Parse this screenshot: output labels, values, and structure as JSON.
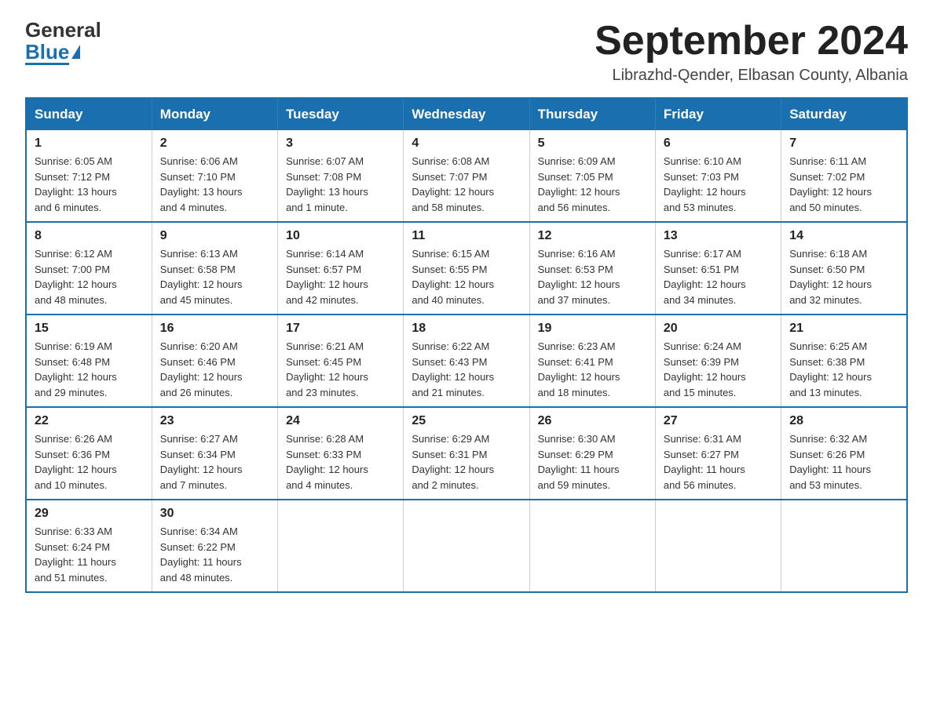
{
  "header": {
    "logo_general": "General",
    "logo_blue": "Blue",
    "month_title": "September 2024",
    "subtitle": "Librazhd-Qender, Elbasan County, Albania"
  },
  "calendar": {
    "days_of_week": [
      "Sunday",
      "Monday",
      "Tuesday",
      "Wednesday",
      "Thursday",
      "Friday",
      "Saturday"
    ],
    "weeks": [
      [
        {
          "day": "1",
          "info": "Sunrise: 6:05 AM\nSunset: 7:12 PM\nDaylight: 13 hours\nand 6 minutes."
        },
        {
          "day": "2",
          "info": "Sunrise: 6:06 AM\nSunset: 7:10 PM\nDaylight: 13 hours\nand 4 minutes."
        },
        {
          "day": "3",
          "info": "Sunrise: 6:07 AM\nSunset: 7:08 PM\nDaylight: 13 hours\nand 1 minute."
        },
        {
          "day": "4",
          "info": "Sunrise: 6:08 AM\nSunset: 7:07 PM\nDaylight: 12 hours\nand 58 minutes."
        },
        {
          "day": "5",
          "info": "Sunrise: 6:09 AM\nSunset: 7:05 PM\nDaylight: 12 hours\nand 56 minutes."
        },
        {
          "day": "6",
          "info": "Sunrise: 6:10 AM\nSunset: 7:03 PM\nDaylight: 12 hours\nand 53 minutes."
        },
        {
          "day": "7",
          "info": "Sunrise: 6:11 AM\nSunset: 7:02 PM\nDaylight: 12 hours\nand 50 minutes."
        }
      ],
      [
        {
          "day": "8",
          "info": "Sunrise: 6:12 AM\nSunset: 7:00 PM\nDaylight: 12 hours\nand 48 minutes."
        },
        {
          "day": "9",
          "info": "Sunrise: 6:13 AM\nSunset: 6:58 PM\nDaylight: 12 hours\nand 45 minutes."
        },
        {
          "day": "10",
          "info": "Sunrise: 6:14 AM\nSunset: 6:57 PM\nDaylight: 12 hours\nand 42 minutes."
        },
        {
          "day": "11",
          "info": "Sunrise: 6:15 AM\nSunset: 6:55 PM\nDaylight: 12 hours\nand 40 minutes."
        },
        {
          "day": "12",
          "info": "Sunrise: 6:16 AM\nSunset: 6:53 PM\nDaylight: 12 hours\nand 37 minutes."
        },
        {
          "day": "13",
          "info": "Sunrise: 6:17 AM\nSunset: 6:51 PM\nDaylight: 12 hours\nand 34 minutes."
        },
        {
          "day": "14",
          "info": "Sunrise: 6:18 AM\nSunset: 6:50 PM\nDaylight: 12 hours\nand 32 minutes."
        }
      ],
      [
        {
          "day": "15",
          "info": "Sunrise: 6:19 AM\nSunset: 6:48 PM\nDaylight: 12 hours\nand 29 minutes."
        },
        {
          "day": "16",
          "info": "Sunrise: 6:20 AM\nSunset: 6:46 PM\nDaylight: 12 hours\nand 26 minutes."
        },
        {
          "day": "17",
          "info": "Sunrise: 6:21 AM\nSunset: 6:45 PM\nDaylight: 12 hours\nand 23 minutes."
        },
        {
          "day": "18",
          "info": "Sunrise: 6:22 AM\nSunset: 6:43 PM\nDaylight: 12 hours\nand 21 minutes."
        },
        {
          "day": "19",
          "info": "Sunrise: 6:23 AM\nSunset: 6:41 PM\nDaylight: 12 hours\nand 18 minutes."
        },
        {
          "day": "20",
          "info": "Sunrise: 6:24 AM\nSunset: 6:39 PM\nDaylight: 12 hours\nand 15 minutes."
        },
        {
          "day": "21",
          "info": "Sunrise: 6:25 AM\nSunset: 6:38 PM\nDaylight: 12 hours\nand 13 minutes."
        }
      ],
      [
        {
          "day": "22",
          "info": "Sunrise: 6:26 AM\nSunset: 6:36 PM\nDaylight: 12 hours\nand 10 minutes."
        },
        {
          "day": "23",
          "info": "Sunrise: 6:27 AM\nSunset: 6:34 PM\nDaylight: 12 hours\nand 7 minutes."
        },
        {
          "day": "24",
          "info": "Sunrise: 6:28 AM\nSunset: 6:33 PM\nDaylight: 12 hours\nand 4 minutes."
        },
        {
          "day": "25",
          "info": "Sunrise: 6:29 AM\nSunset: 6:31 PM\nDaylight: 12 hours\nand 2 minutes."
        },
        {
          "day": "26",
          "info": "Sunrise: 6:30 AM\nSunset: 6:29 PM\nDaylight: 11 hours\nand 59 minutes."
        },
        {
          "day": "27",
          "info": "Sunrise: 6:31 AM\nSunset: 6:27 PM\nDaylight: 11 hours\nand 56 minutes."
        },
        {
          "day": "28",
          "info": "Sunrise: 6:32 AM\nSunset: 6:26 PM\nDaylight: 11 hours\nand 53 minutes."
        }
      ],
      [
        {
          "day": "29",
          "info": "Sunrise: 6:33 AM\nSunset: 6:24 PM\nDaylight: 11 hours\nand 51 minutes."
        },
        {
          "day": "30",
          "info": "Sunrise: 6:34 AM\nSunset: 6:22 PM\nDaylight: 11 hours\nand 48 minutes."
        },
        {
          "day": "",
          "info": ""
        },
        {
          "day": "",
          "info": ""
        },
        {
          "day": "",
          "info": ""
        },
        {
          "day": "",
          "info": ""
        },
        {
          "day": "",
          "info": ""
        }
      ]
    ]
  }
}
